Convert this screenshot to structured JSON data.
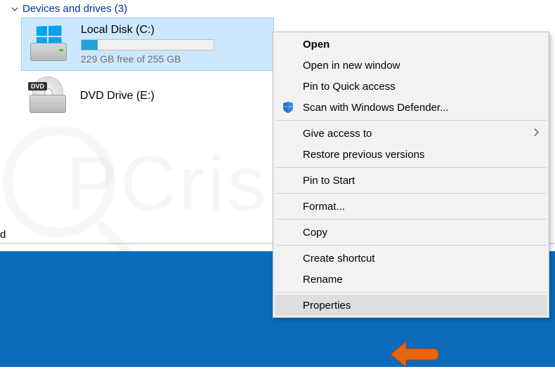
{
  "section": {
    "title": "Devices and drives (3)"
  },
  "drives": [
    {
      "name": "Local Disk (C:)",
      "status": "229 GB free of 255 GB",
      "fill_percent": 12,
      "selected": true,
      "type": "hdd"
    },
    {
      "name": "DVD Drive (E:)",
      "status": "",
      "type": "dvd"
    }
  ],
  "context_menu": {
    "open": "Open",
    "open_new_window": "Open in new window",
    "pin_quick_access": "Pin to Quick access",
    "scan_defender": "Scan with Windows Defender...",
    "give_access": "Give access to",
    "restore_versions": "Restore previous versions",
    "pin_start": "Pin to Start",
    "format": "Format...",
    "copy": "Copy",
    "create_shortcut": "Create shortcut",
    "rename": "Rename",
    "properties": "Properties"
  },
  "partial_text": "d",
  "colors": {
    "selection_bg": "#cce8ff",
    "accent": "#26a0da",
    "band": "#0a6bbd",
    "callout": "#e8650d"
  }
}
